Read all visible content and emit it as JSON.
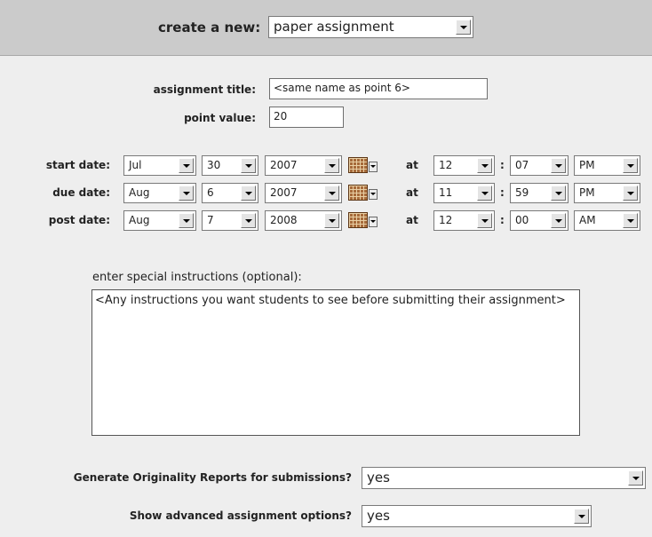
{
  "header": {
    "label": "create a new:",
    "type_select": "paper assignment"
  },
  "form": {
    "title_label": "assignment title:",
    "title_value": "<same name as point 6>",
    "points_label": "point value:",
    "points_value": "20",
    "at_label": "at",
    "colon": ":",
    "dates": [
      {
        "label": "start date:",
        "month": "Jul",
        "day": "30",
        "year": "2007",
        "hour": "12",
        "minute": "07",
        "ampm": "PM"
      },
      {
        "label": "due date:",
        "month": "Aug",
        "day": "6",
        "year": "2007",
        "hour": "11",
        "minute": "59",
        "ampm": "PM"
      },
      {
        "label": "post date:",
        "month": "Aug",
        "day": "7",
        "year": "2008",
        "hour": "12",
        "minute": "00",
        "ampm": "AM"
      }
    ],
    "instructions_label": "enter special instructions (optional):",
    "instructions_value": "<Any instructions you want students to see before submitting their assignment>",
    "originality_label": "Generate Originality Reports for submissions?",
    "originality_value": "yes",
    "advanced_label": "Show advanced assignment options?",
    "advanced_value": "yes"
  },
  "icons": {
    "calendar": "calendar-icon",
    "dropdown": "chevron-down-icon"
  }
}
